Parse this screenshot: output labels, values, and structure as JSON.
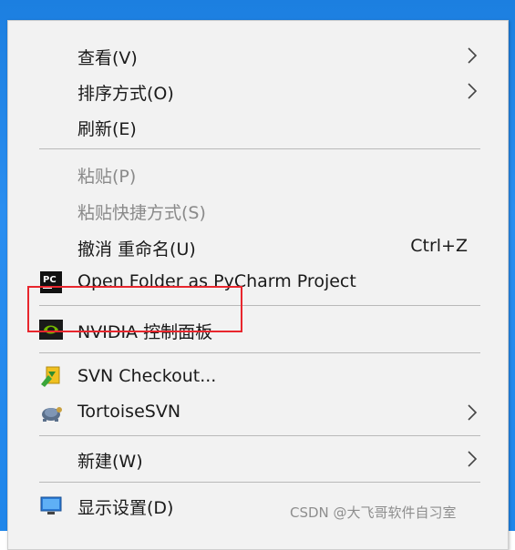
{
  "menu": {
    "view_label": "查看(V)",
    "sort_label": "排序方式(O)",
    "refresh_label": "刷新(E)",
    "paste_label": "粘贴(P)",
    "paste_shortcut_label": "粘贴快捷方式(S)",
    "undo_label": "撤消 重命名(U)",
    "undo_shortcut": "Ctrl+Z",
    "pycharm_label": "Open Folder as PyCharm Project",
    "nvidia_label": "NVIDIA 控制面板",
    "svn_checkout_label": "SVN Checkout...",
    "tortoise_label": "TortoiseSVN",
    "new_label": "新建(W)",
    "display_label": "显示设置(D)"
  },
  "watermark": "CSDN @大飞哥软件自习室",
  "colors": {
    "menu_bg": "#f2f2f2",
    "highlight": "#e8262d",
    "disabled_text": "#8a8a8a",
    "desktop": "#1f86ea"
  },
  "icons": {
    "pycharm": "pycharm-icon",
    "nvidia": "nvidia-icon",
    "svn_checkout": "svn-checkout-icon",
    "tortoise": "tortoisesvn-icon",
    "display": "display-icon",
    "submenu": "chevron-right-icon"
  }
}
